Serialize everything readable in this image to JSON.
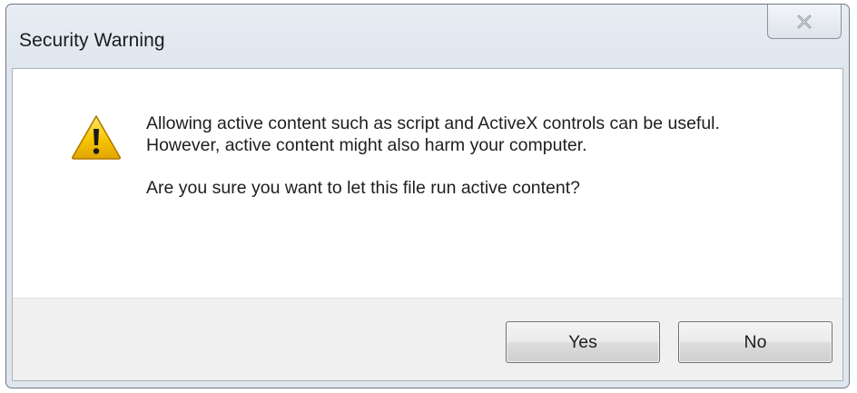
{
  "window": {
    "title": "Security Warning",
    "close_icon": "close-icon"
  },
  "dialog": {
    "icon": "warning-icon",
    "message_line1": "Allowing active content such as script and ActiveX controls can be useful.",
    "message_line2": "However, active content might also harm your computer.",
    "question": "Are you sure you want to let this file run active content?"
  },
  "buttons": {
    "yes_label": "Yes",
    "no_label": "No"
  },
  "colors": {
    "frame": "#dfe6ee",
    "button_area": "#f0f0f0",
    "warning_yellow": "#f5c400"
  }
}
